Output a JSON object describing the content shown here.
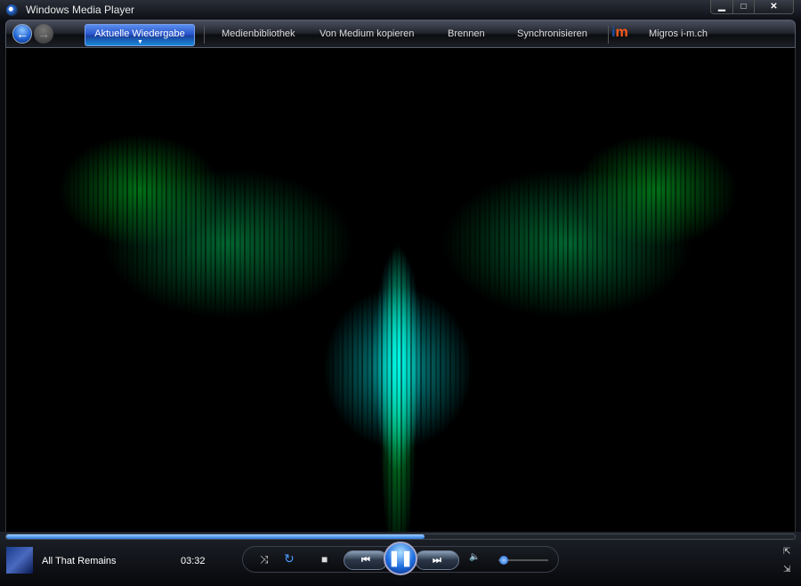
{
  "window": {
    "title": "Windows Media Player",
    "minimize": "▁",
    "maximize": "□",
    "close": "✕"
  },
  "nav": {
    "back": "←",
    "forward": "→",
    "tabs": [
      "Aktuelle Wiedergabe",
      "Medienbibliothek",
      "Von Medium kopieren",
      "Brennen",
      "Synchronisieren"
    ],
    "store_logo": {
      "i": "i",
      "m": "m"
    },
    "store": "Migros i-m.ch"
  },
  "player": {
    "track": "All That Remains",
    "time": "03:32",
    "progress_percent": 53,
    "volume_percent": 10,
    "icons": {
      "shuffle": "⤨",
      "repeat": "↻",
      "stop": "■",
      "prev": "⏮",
      "pause": "❚❚",
      "next": "⏭",
      "volume": "🔈",
      "switch_mode": "⇱",
      "compact": "⇲"
    }
  }
}
